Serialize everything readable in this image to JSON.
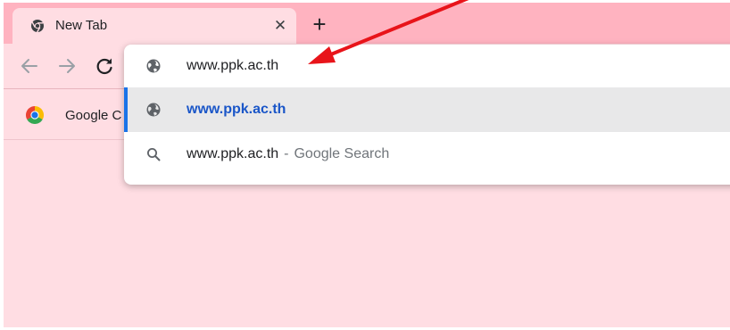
{
  "tab": {
    "title": "New Tab",
    "close_icon": "close-icon",
    "favicon_icon": "chrome-newtab-icon"
  },
  "new_tab": {
    "icon": "plus-icon"
  },
  "toolbar": {
    "back_icon": "arrow-left-icon",
    "forward_icon": "arrow-right-icon",
    "reload_icon": "reload-icon"
  },
  "bookmarks": {
    "items": [
      {
        "label": "Google C",
        "icon": "chrome-icon"
      }
    ]
  },
  "omnibox": {
    "input_value": "www.ppk.ac.th",
    "input_icon": "globe-icon",
    "suggestions": [
      {
        "text": "www.ppk.ac.th",
        "icon": "globe-icon"
      },
      {
        "text": "www.ppk.ac.th",
        "separator": "-",
        "description": "Google Search",
        "icon": "search-icon"
      }
    ]
  },
  "annotation": {
    "color": "#e8141a",
    "icon": "red-arrow-annotation"
  },
  "colors": {
    "tab_strip": "#ffb3c0",
    "page_background": "#ffdde3",
    "highlight_row": "#e8e8e9",
    "accent": "#1a73e8",
    "url_blue": "#1a56c8"
  }
}
